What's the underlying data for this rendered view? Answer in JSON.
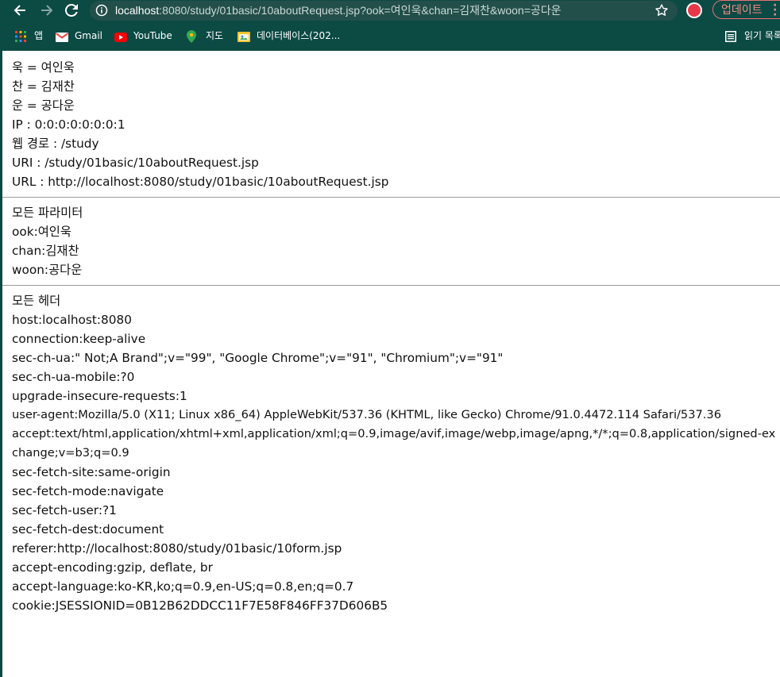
{
  "browser": {
    "url_host": "localhost",
    "url_rest": ":8080/study/01basic/10aboutRequest.jsp?ook=여인욱&chan=김재찬&woon=공다운",
    "update_label": "업데이트",
    "bookmarks": [
      {
        "label": "앱",
        "icon": "apps-grid-icon"
      },
      {
        "label": "Gmail",
        "icon": "gmail-icon"
      },
      {
        "label": "YouTube",
        "icon": "youtube-icon"
      },
      {
        "label": "지도",
        "icon": "maps-pin-icon"
      },
      {
        "label": "데이터베이스(202...",
        "icon": "folder-icon"
      }
    ],
    "reading_list_label": "읽기 목록"
  },
  "colors": {
    "chrome_bg": "#0c4a44",
    "omnibox_bg": "#234f4a",
    "update_accent": "#f28b82"
  },
  "request_info": [
    "욱 = 여인욱",
    "찬 = 김재찬",
    "운 = 공다운",
    "IP : 0:0:0:0:0:0:0:1",
    "웹 경로 : /study",
    "URI : /study/01basic/10aboutRequest.jsp",
    "URL : http://localhost:8080/study/01basic/10aboutRequest.jsp"
  ],
  "params": {
    "heading": "모든 파라미터",
    "items": [
      "ook:여인욱",
      "chan:김재찬",
      "woon:공다운"
    ]
  },
  "headers": {
    "heading": "모든 헤더",
    "items": [
      "host:localhost:8080",
      "connection:keep-alive",
      "sec-ch-ua:\" Not;A Brand\";v=\"99\", \"Google Chrome\";v=\"91\", \"Chromium\";v=\"91\"",
      "sec-ch-ua-mobile:?0",
      "upgrade-insecure-requests:1",
      "user-agent:Mozilla/5.0 (X11; Linux x86_64) AppleWebKit/537.36 (KHTML, like Gecko) Chrome/91.0.4472.114 Safari/537.36",
      "accept:text/html,application/xhtml+xml,application/xml;q=0.9,image/avif,image/webp,image/apng,*/*;q=0.8,application/signed-exchange;v=b3;q=0.9",
      "sec-fetch-site:same-origin",
      "sec-fetch-mode:navigate",
      "sec-fetch-user:?1",
      "sec-fetch-dest:document",
      "referer:http://localhost:8080/study/01basic/10form.jsp",
      "accept-encoding:gzip, deflate, br",
      "accept-language:ko-KR,ko;q=0.9,en-US;q=0.8,en;q=0.7",
      "cookie:JSESSIONID=0B12B62DDCC11F7E58F846FF37D606B5"
    ]
  }
}
